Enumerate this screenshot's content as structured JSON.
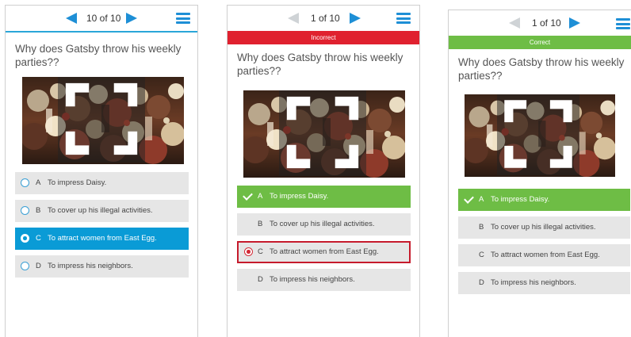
{
  "screens": [
    {
      "counter": "10 of 10",
      "question": "Why does Gatsby throw his weekly parties??",
      "options": [
        {
          "letter": "A",
          "text": "To impress Daisy."
        },
        {
          "letter": "B",
          "text": "To cover up his illegal activities."
        },
        {
          "letter": "C",
          "text": "To attract women from East Egg."
        },
        {
          "letter": "D",
          "text": "To impress his neighbors."
        }
      ]
    },
    {
      "counter": "1 of 10",
      "status": "Incorrect",
      "question": "Why does Gatsby throw his weekly parties??",
      "options": [
        {
          "letter": "A",
          "text": "To impress Daisy."
        },
        {
          "letter": "B",
          "text": "To cover up his illegal activities."
        },
        {
          "letter": "C",
          "text": "To attract women from East Egg."
        },
        {
          "letter": "D",
          "text": "To impress his neighbors."
        }
      ]
    },
    {
      "counter": "1 of 10",
      "status": "Correct",
      "question": "Why does Gatsby throw his weekly parties??",
      "options": [
        {
          "letter": "A",
          "text": "To impress Daisy."
        },
        {
          "letter": "B",
          "text": "To cover up his illegal activities."
        },
        {
          "letter": "C",
          "text": "To attract women from East Egg."
        },
        {
          "letter": "D",
          "text": "To impress his neighbors."
        }
      ]
    }
  ],
  "icons": {
    "prev": "arrow-left-icon",
    "next": "arrow-right-icon",
    "menu": "hamburger-menu-icon",
    "expand": "expand-icon",
    "radio": "radio-icon",
    "check": "checkmark-icon"
  },
  "colors": {
    "accent_blue": "#1e8fd6",
    "selected_blue": "#0a9bd6",
    "correct_green": "#6ebd45",
    "incorrect_red": "#e0212f",
    "option_gray": "#e6e6e6"
  }
}
